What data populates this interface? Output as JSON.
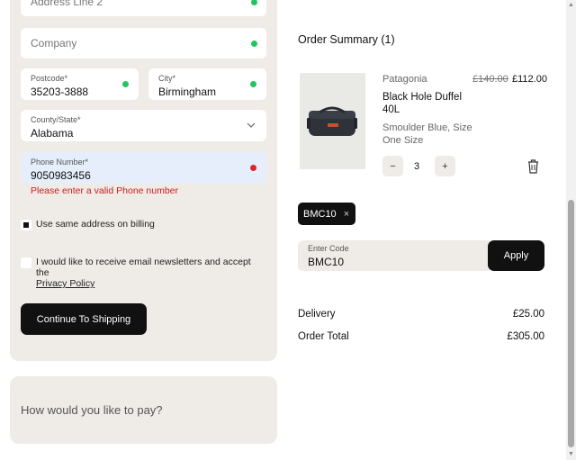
{
  "form": {
    "address_line2": {
      "placeholder": "Address Line 2"
    },
    "company": {
      "placeholder": "Company"
    },
    "postcode": {
      "label": "Postcode*",
      "value": "35203-3888"
    },
    "city": {
      "label": "City*",
      "value": "Birmingham"
    },
    "county": {
      "label": "County/State*",
      "value": "Alabama"
    },
    "phone": {
      "label": "Phone Number*",
      "value": "9050983456",
      "error": "Please enter a valid Phone number"
    },
    "same_address_label": "Use same address on billing",
    "newsletter_label": "I would like to receive email newsletters and accept the",
    "privacy_link": "Privacy Policy",
    "continue_button": "Continue To Shipping"
  },
  "payment": {
    "heading": "How would you like to pay?"
  },
  "summary": {
    "title": "Order Summary (1)",
    "item": {
      "brand": "Patagonia",
      "name": "Black Hole Duffel 40L",
      "variant": "Smoulder Blue, Size One Size",
      "original_price": "£140.00",
      "price": "£112.00",
      "quantity": "3",
      "minus": "−",
      "plus": "+"
    },
    "promo": {
      "applied_code": "BMC10",
      "remove": "×",
      "input_label": "Enter Code",
      "input_value": "BMC10",
      "apply_button": "Apply"
    },
    "delivery_label": "Delivery",
    "delivery_value": "£25.00",
    "total_label": "Order Total",
    "total_value": "£305.00"
  },
  "colors": {
    "panel": "#efebe7",
    "dark": "#111111",
    "ok": "#22c55e",
    "error": "#dc2626"
  }
}
